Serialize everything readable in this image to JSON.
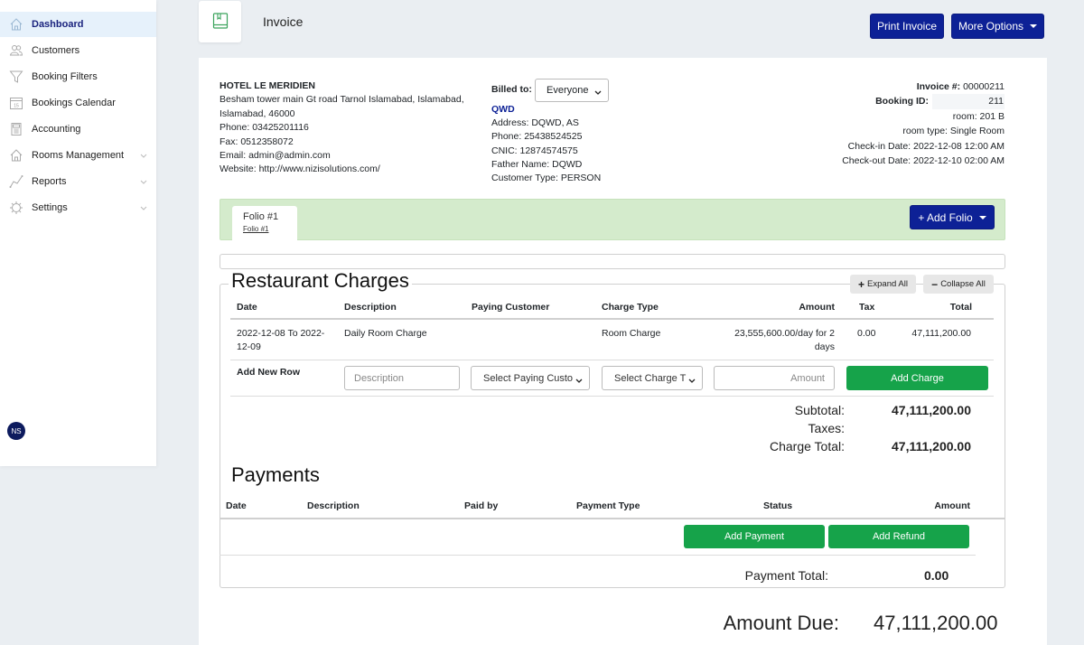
{
  "sidebar": {
    "items": [
      {
        "label": "Dashboard",
        "icon": "home-icon",
        "active": true,
        "expandable": false
      },
      {
        "label": "Customers",
        "icon": "users-icon",
        "active": false,
        "expandable": false
      },
      {
        "label": "Booking Filters",
        "icon": "filter-icon",
        "active": false,
        "expandable": false
      },
      {
        "label": "Bookings Calendar",
        "icon": "calendar-icon",
        "active": false,
        "expandable": false
      },
      {
        "label": "Accounting",
        "icon": "calculator-icon",
        "active": false,
        "expandable": false
      },
      {
        "label": "Rooms Management",
        "icon": "building-icon",
        "active": false,
        "expandable": true
      },
      {
        "label": "Reports",
        "icon": "chart-line-icon",
        "active": false,
        "expandable": true
      },
      {
        "label": "Settings",
        "icon": "gear-icon",
        "active": false,
        "expandable": true
      }
    ],
    "calendar_icon_text": "15",
    "user_initials": "NS"
  },
  "header": {
    "title": "Invoice",
    "print_button": "Print Invoice",
    "more_options_button": "More Options"
  },
  "hotel": {
    "name": "HOTEL LE MERIDIEN",
    "address_line1": "Besham tower main Gt road Tarnol Islamabad, Islamabad,",
    "address_line2": "Islamabad, 46000",
    "phone": "Phone: 03425201116",
    "fax": "Fax: 0512358072",
    "email": "Email: admin@admin.com",
    "website": "Website: http://www.nizisolutions.com/"
  },
  "billing": {
    "label": "Billed to:",
    "selected": "Everyone",
    "customer_name": "QWD",
    "address": "Address: DQWD, AS",
    "phone": "Phone: 25438524525",
    "cnic": "CNIC: 12874574575",
    "father_name": "Father Name: DQWD",
    "customer_type": "Customer Type: PERSON"
  },
  "invoice": {
    "invoice_label": "Invoice #:",
    "invoice_number": "00000211",
    "booking_label": "Booking ID:",
    "booking_id": "211",
    "room": "room: 201 B",
    "room_type": "room type: Single Room",
    "checkin": "Check-in Date: 2022-12-08 12:00 AM",
    "checkout": "Check-out Date: 2022-12-10 02:00 AM"
  },
  "folio": {
    "tab_title": "Folio #1",
    "tab_link": "Folio #1",
    "add_folio_button": "+ Add Folio"
  },
  "charges": {
    "title": "Restaurant Charges",
    "expand_all": "Expand All",
    "collapse_all": "Collapse All",
    "columns": [
      "Date",
      "Description",
      "Paying Customer",
      "Charge Type",
      "Amount",
      "Tax",
      "Total"
    ],
    "rows": [
      {
        "date_line1": "2022-12-08 To 2022-",
        "date_line2": "12-09",
        "description": "Daily Room Charge",
        "paying_customer": "",
        "charge_type": "Room Charge",
        "amount_line1": "23,555,600.00/day for 2",
        "amount_line2": "days",
        "tax": "0.00",
        "total": "47,111,200.00"
      }
    ],
    "new_row": {
      "label": "Add New Row",
      "description_placeholder": "Description",
      "paying_customer_select": "Select Paying Custo",
      "charge_type_select": "Select Charge T",
      "amount_placeholder": "Amount",
      "add_button": "Add Charge"
    },
    "subtotal_label": "Subtotal:",
    "subtotal": "47,111,200.00",
    "taxes_label": "Taxes:",
    "taxes": "",
    "charge_total_label": "Charge Total:",
    "charge_total": "47,111,200.00"
  },
  "payments": {
    "title": "Payments",
    "columns": [
      "Date",
      "Description",
      "Paid by",
      "Payment Type",
      "Status",
      "Amount"
    ],
    "add_payment_button": "Add Payment",
    "add_refund_button": "Add Refund",
    "total_label": "Payment Total:",
    "total": "0.00"
  },
  "amount_due": {
    "label": "Amount Due:",
    "value": "47,111,200.00"
  },
  "colors": {
    "primary": "#0d2196",
    "success": "#16a34a",
    "folio_bar": "#d4ebcc",
    "active_sidebar": "#e6f1fb"
  }
}
